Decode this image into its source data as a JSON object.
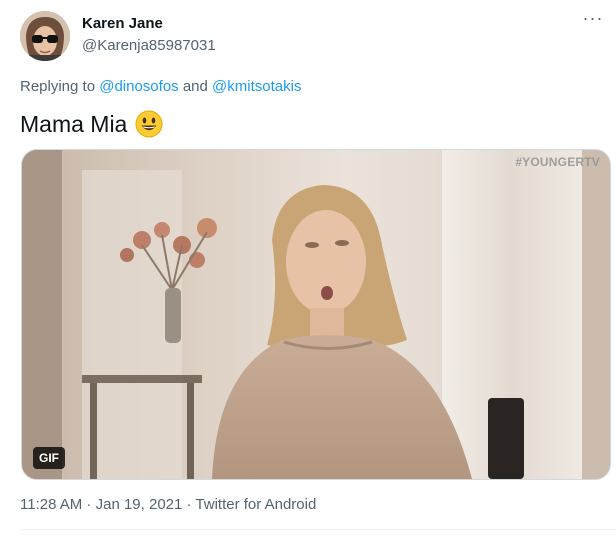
{
  "author": {
    "display_name": "Karen Jane",
    "handle": "@Karenja85987031"
  },
  "more_menu": {
    "label": "···",
    "icon": "more-horizontal-icon"
  },
  "reply_context": {
    "prefix": "Replying to ",
    "mention_1": "@dinosofos",
    "conjunction": " and ",
    "mention_2": "@kmitsotakis"
  },
  "tweet": {
    "text": "Mama Mia",
    "emoji": "grinning-face-icon"
  },
  "media": {
    "type": "gif",
    "watermark": "#YOUNGERTV",
    "badge": "GIF"
  },
  "meta": {
    "time": "11:28 AM",
    "separator_1": " · ",
    "date": "Jan 19, 2021",
    "separator_2": " · ",
    "source": "Twitter for Android"
  },
  "colors": {
    "primary_text": "#0f1419",
    "secondary_text": "#536471",
    "link": "#1d9bf0",
    "badge_bg": "#000000"
  }
}
